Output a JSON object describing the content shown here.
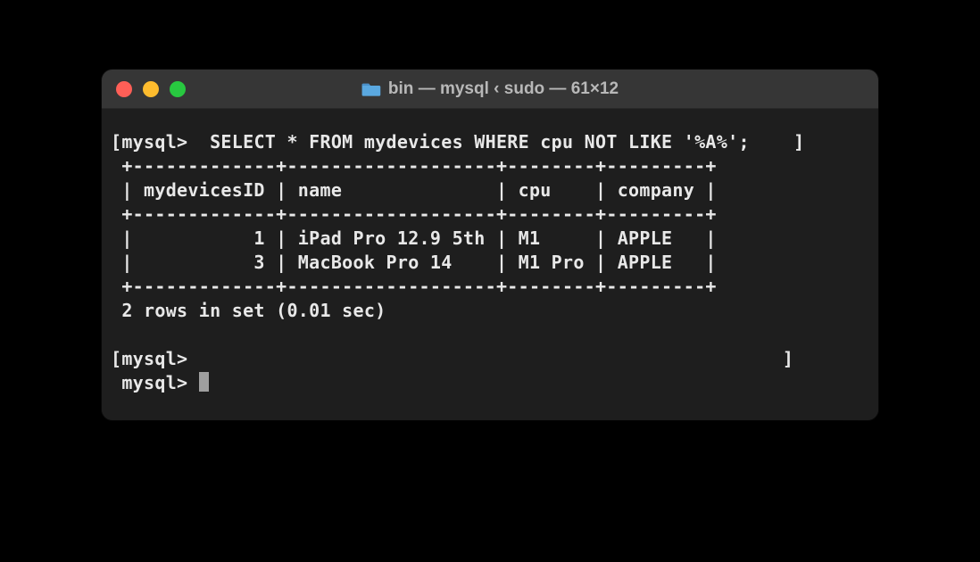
{
  "window": {
    "title": "bin — mysql ‹ sudo — 61×12"
  },
  "terminal": {
    "prompt": "mysql>",
    "prompt_bracket_open": "[mysql>",
    "prompt_bracket_close": "]",
    "command": " SELECT * FROM mydevices WHERE cpu NOT LIKE '%A%';",
    "table_border": "+-------------+-------------------+--------+---------+",
    "table_header": "| mydevicesID | name              | cpu    | company |",
    "row1": "|           1 | iPad Pro 12.9 5th | M1     | APPLE   |",
    "row2": "|           3 | MacBook Pro 14    | M1 Pro | APPLE   |",
    "result_status": "2 rows in set (0.01 sec)",
    "chart_data": {
      "type": "table",
      "columns": [
        "mydevicesID",
        "name",
        "cpu",
        "company"
      ],
      "rows": [
        {
          "mydevicesID": 1,
          "name": "iPad Pro 12.9 5th",
          "cpu": "M1",
          "company": "APPLE"
        },
        {
          "mydevicesID": 3,
          "name": "MacBook Pro 14",
          "cpu": "M1 Pro",
          "company": "APPLE"
        }
      ],
      "row_count": 2,
      "elapsed_sec": 0.01
    }
  }
}
